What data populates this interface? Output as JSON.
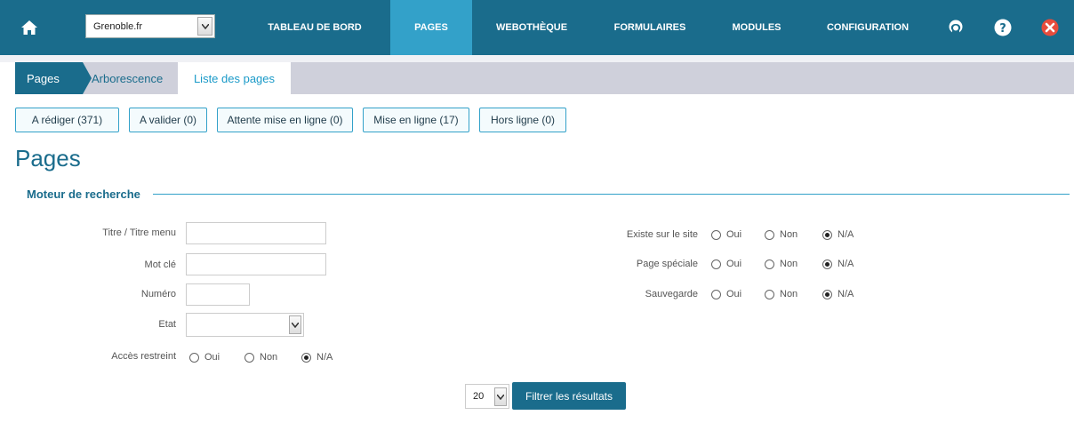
{
  "topbar": {
    "site_select": {
      "value": "Grenoble.fr"
    },
    "menu": [
      {
        "label": "TABLEAU DE BORD"
      },
      {
        "label": "PAGES"
      },
      {
        "label": "WEBOTHÈQUE"
      },
      {
        "label": "FORMULAIRES"
      },
      {
        "label": "MODULES"
      },
      {
        "label": "CONFIGURATION"
      }
    ],
    "active_menu": "PAGES",
    "icons": [
      "home-icon",
      "lifebuoy-icon",
      "help-icon",
      "close-icon"
    ],
    "colors": {
      "bar": "#1a6c8c",
      "active": "#33a1c9",
      "close": "#e74c3c"
    }
  },
  "breadcrumb_tabs": {
    "pages": "Pages",
    "arborescence": "Arborescence",
    "liste": "Liste des pages"
  },
  "status_filters": [
    {
      "label": "A rédiger (371)"
    },
    {
      "label": "A valider (0)"
    },
    {
      "label": "Attente mise en ligne (0)"
    },
    {
      "label": "Mise en ligne (17)"
    },
    {
      "label": "Hors ligne (0)"
    }
  ],
  "page_title": "Pages",
  "search": {
    "section_title": "Moteur de recherche",
    "fields": {
      "titre_label": "Titre / Titre menu",
      "titre_value": "",
      "motcle_label": "Mot clé",
      "motcle_value": "",
      "numero_label": "Numéro",
      "numero_value": "",
      "etat_label": "Etat",
      "etat_value": "",
      "acces_label": "Accès restreint"
    },
    "radio_options": {
      "oui": "Oui",
      "non": "Non",
      "na": "N/A"
    },
    "right_groups": [
      {
        "label": "Existe sur le site",
        "selected": "N/A"
      },
      {
        "label": "Page spéciale",
        "selected": "N/A"
      },
      {
        "label": "Sauvegarde",
        "selected": "N/A"
      }
    ],
    "acces_selected": "N/A"
  },
  "pagination": {
    "per_page": "20",
    "filter_button": "Filtrer les résultats"
  }
}
